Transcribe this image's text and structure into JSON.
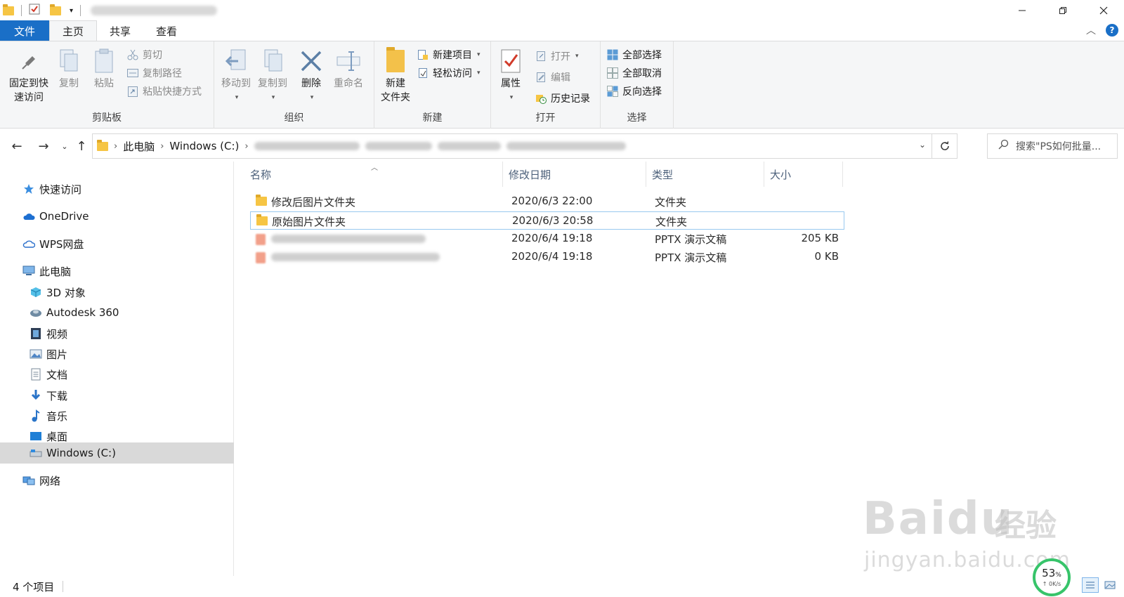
{
  "titlebar": {
    "icons": [
      "folder-icon",
      "properties-check-icon",
      "new-folder-icon",
      "customize-toolbar-icon"
    ]
  },
  "tabs": [
    {
      "label": "文件"
    },
    {
      "label": "主页"
    },
    {
      "label": "共享"
    },
    {
      "label": "查看"
    }
  ],
  "ribbon": {
    "clipboard": {
      "pin": "固定到快\n速访问",
      "copy": "复制",
      "paste": "粘贴",
      "cut": "剪切",
      "copy_path": "复制路径",
      "paste_shortcut": "粘贴快捷方式",
      "label": "剪贴板"
    },
    "organize": {
      "move_to": "移动到",
      "copy_to": "复制到",
      "delete": "删除",
      "rename": "重命名",
      "label": "组织"
    },
    "new": {
      "new_folder": "新建\n文件夹",
      "new_item": "新建项目",
      "easy_access": "轻松访问",
      "label": "新建"
    },
    "open": {
      "properties": "属性",
      "open": "打开",
      "edit": "编辑",
      "history": "历史记录",
      "label": "打开"
    },
    "select": {
      "select_all": "全部选择",
      "select_none": "全部取消",
      "invert": "反向选择",
      "label": "选择"
    }
  },
  "address": {
    "crumbs": [
      "此电脑",
      "Windows (C:)"
    ],
    "search_placeholder": "搜索\"PS如何批量..."
  },
  "sidebar": {
    "items": [
      {
        "label": "快速访问",
        "icon": "star-icon"
      },
      {
        "label": "OneDrive",
        "icon": "onedrive-cloud-icon"
      },
      {
        "label": "WPS网盘",
        "icon": "wps-cloud-icon"
      },
      {
        "label": "此电脑",
        "icon": "this-pc-icon"
      },
      {
        "label": "3D 对象",
        "icon": "cube-3d-icon"
      },
      {
        "label": "Autodesk 360",
        "icon": "autodesk-icon"
      },
      {
        "label": "视频",
        "icon": "video-icon"
      },
      {
        "label": "图片",
        "icon": "pictures-icon"
      },
      {
        "label": "文档",
        "icon": "documents-icon"
      },
      {
        "label": "下载",
        "icon": "download-arrow-icon"
      },
      {
        "label": "音乐",
        "icon": "music-note-icon"
      },
      {
        "label": "桌面",
        "icon": "desktop-icon"
      },
      {
        "label": "Windows (C:)",
        "icon": "drive-icon",
        "selected": true
      },
      {
        "label": "网络",
        "icon": "network-icon"
      }
    ]
  },
  "filelist": {
    "columns": [
      "名称",
      "修改日期",
      "类型",
      "大小"
    ],
    "rows": [
      {
        "name": "修改后图片文件夹",
        "date": "2020/6/3 22:00",
        "type": "文件夹",
        "size": ""
      },
      {
        "name": "原始图片文件夹",
        "date": "2020/6/3 20:58",
        "type": "文件夹",
        "size": ""
      },
      {
        "name": "",
        "date": "2020/6/4 19:18",
        "type": "PPTX 演示文稿",
        "size": "205 KB"
      },
      {
        "name": "",
        "date": "2020/6/4 19:18",
        "type": "PPTX 演示文稿",
        "size": "0 KB"
      }
    ]
  },
  "status": {
    "count": "4 个项目"
  },
  "netmonitor": {
    "percent": "53",
    "percent_unit": "%",
    "speed": "↑ 0K/s"
  },
  "watermark": {
    "brand": "Bai",
    "brand2": "du",
    "cn": "经验",
    "url": "jingyan.baidu.com"
  },
  "colors": {
    "accent": "#1a6fc7",
    "ribbon_bg": "#f5f6f7",
    "selected_nav": "#d9d9d9",
    "folder": "#f6c544",
    "gauge": "#37c46a"
  }
}
